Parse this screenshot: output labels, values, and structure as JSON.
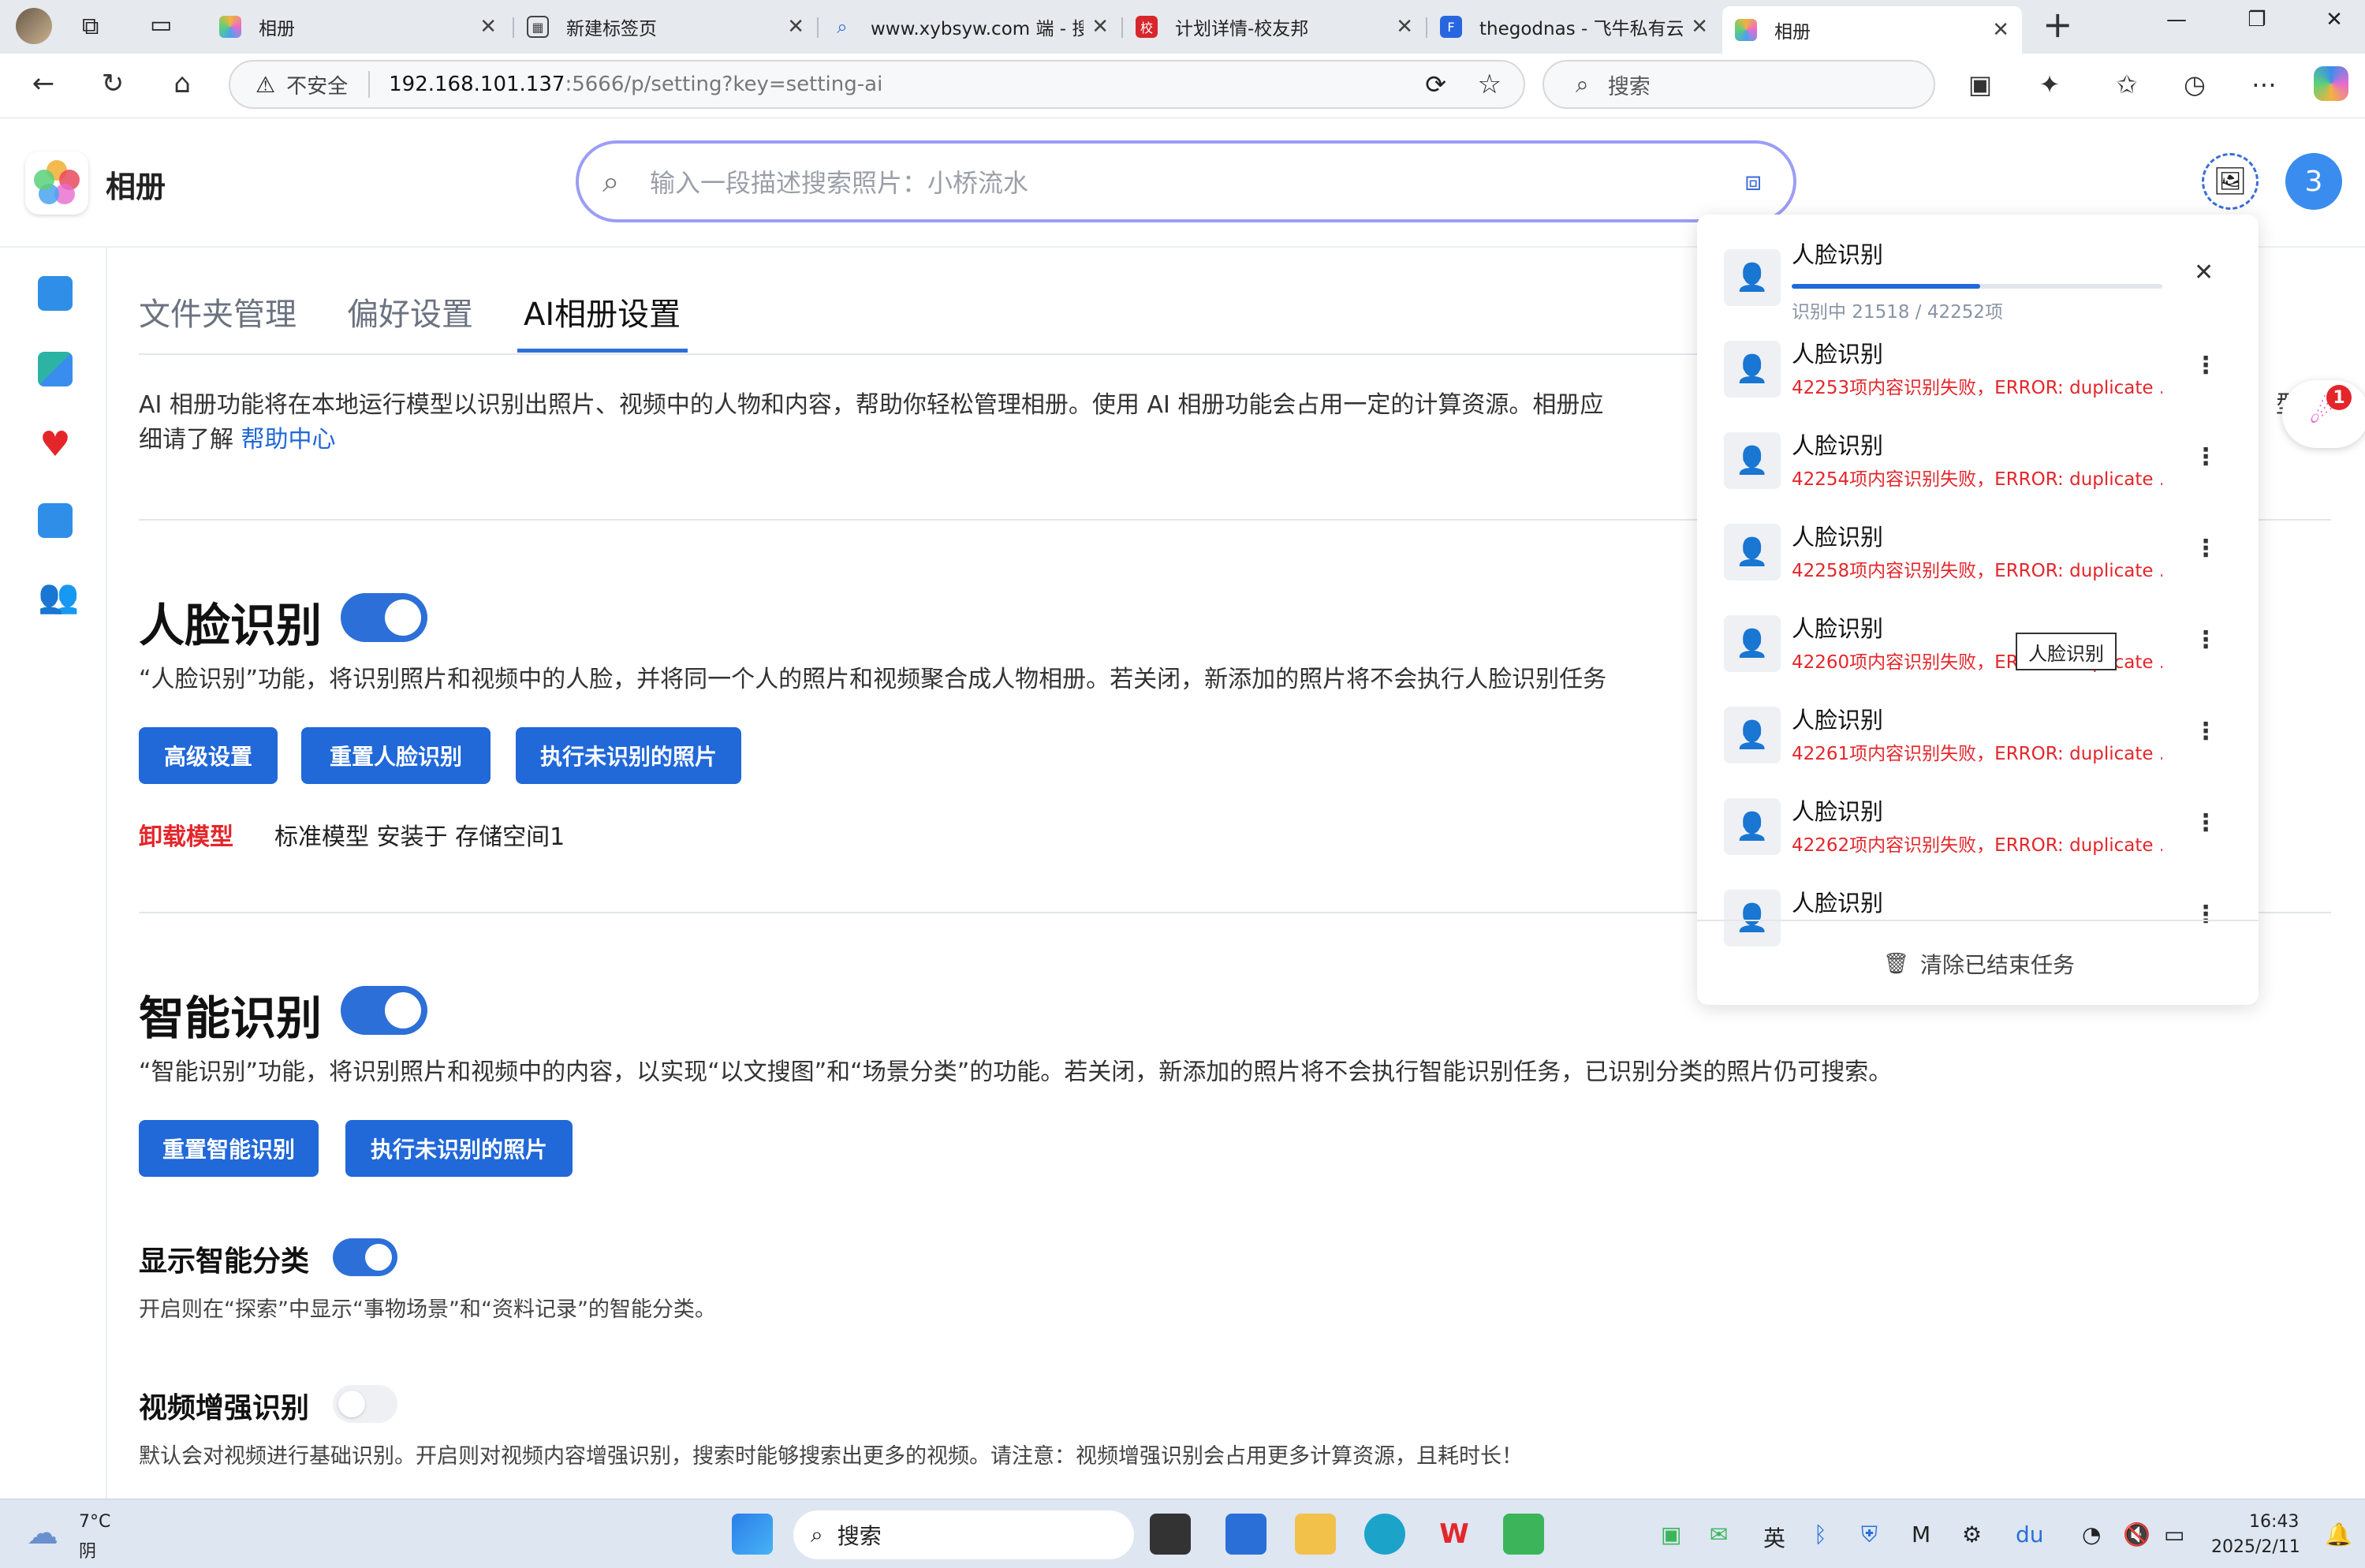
{
  "browser": {
    "tabs": [
      {
        "label": "相册",
        "icon_color": "#e86ad0"
      },
      {
        "label": "新建标签页",
        "icon_color": "#444444"
      },
      {
        "label": "www.xybsyw.com 端 - 搜",
        "icon_color": "#2e6fe0"
      },
      {
        "label": "计划详情-校友邦",
        "icon_color": "#d8262d"
      },
      {
        "label": "thegodnas - 飞牛私有云",
        "icon_color": "#2866e0"
      },
      {
        "label": "相册",
        "icon_color": "#e86ad0"
      }
    ],
    "tab_close": "✕",
    "new_tab": "+",
    "window_controls": [
      "—",
      "❐",
      "✕"
    ],
    "security_label": "不安全",
    "url_host": "192.168.101.137",
    "url_rest": ":5666/p/setting?key=setting-ai",
    "search_placeholder": "搜索"
  },
  "app": {
    "title": "相册",
    "search_placeholder": "输入一段描述搜索照片：小桥流水",
    "avatar_text": "3"
  },
  "settings": {
    "tabs": [
      "文件夹管理",
      "偏好设置",
      "AI相册设置"
    ],
    "intro_line1": "AI 相册功能将在本地运行模型以识别出照片、视频中的人物和内容，帮助你轻松管理相册。使用 AI 相册功能会占用一定的计算资源。相册应",
    "intro_line1_tail": "型，",
    "intro_line2": "细请了解 ",
    "help_link": "帮助中心",
    "face": {
      "title": "人脸识别",
      "enabled": true,
      "desc": "“人脸识别”功能，将识别照片和视频中的人脸，并将同一个人的照片和视频聚合成人物相册。若关闭，新添加的照片将不会执行人脸识别任务",
      "buttons": [
        "高级设置",
        "重置人脸识别",
        "执行未识别的照片"
      ],
      "uninstall": "卸载模型",
      "model_info": "标准模型 安装于 存储空间1"
    },
    "smart": {
      "title": "智能识别",
      "enabled": true,
      "desc": "“智能识别”功能，将识别照片和视频中的内容，以实现“以文搜图”和“场景分类”的功能。若关闭，新添加的照片将不会执行智能识别任务，已识别分类的照片仍可搜索。",
      "buttons": [
        "重置智能识别",
        "执行未识别的照片"
      ]
    },
    "show_category": {
      "title": "显示智能分类",
      "enabled": true,
      "desc": "开启则在“探索”中显示“事物场景”和“资料记录”的智能分类。"
    },
    "video_enhance": {
      "title": "视频增强识别",
      "enabled": false,
      "desc": "默认会对视频进行基础识别。开启则对视频内容增强识别，搜索时能够搜索出更多的视频。请注意：视频增强识别会占用更多计算资源，且耗时长！"
    }
  },
  "task_panel": {
    "current": {
      "title": "人脸识别",
      "status": "识别中 21518 / 42252项",
      "done": 21518,
      "total": 42252
    },
    "failed": [
      {
        "title": "人脸识别",
        "error": "42253项内容识别失败，ERROR: duplicate ..."
      },
      {
        "title": "人脸识别",
        "error": "42254项内容识别失败，ERROR: duplicate ..."
      },
      {
        "title": "人脸识别",
        "error": "42258项内容识别失败，ERROR: duplicate ..."
      },
      {
        "title": "人脸识别",
        "error": "42260项内容识别失败，ERROR: duplicate ..."
      },
      {
        "title": "人脸识别",
        "error": "42261项内容识别失败，ERROR: duplicate ..."
      },
      {
        "title": "人脸识别",
        "error": "42262项内容识别失败，ERROR: duplicate ..."
      },
      {
        "title": "人脸识别",
        "error": ""
      }
    ],
    "clear_label": "清除已结束任务",
    "tooltip": "人脸识别",
    "notify_count": "1"
  },
  "taskbar": {
    "weather_temp": "7°C",
    "weather_desc": "阴",
    "search_label": "搜索",
    "ime": "英",
    "time": "16:43",
    "date": "2025/2/11"
  },
  "colors": {
    "accent": "#2168d9",
    "error": "#e4262b",
    "search_border": "#9b9df7"
  }
}
